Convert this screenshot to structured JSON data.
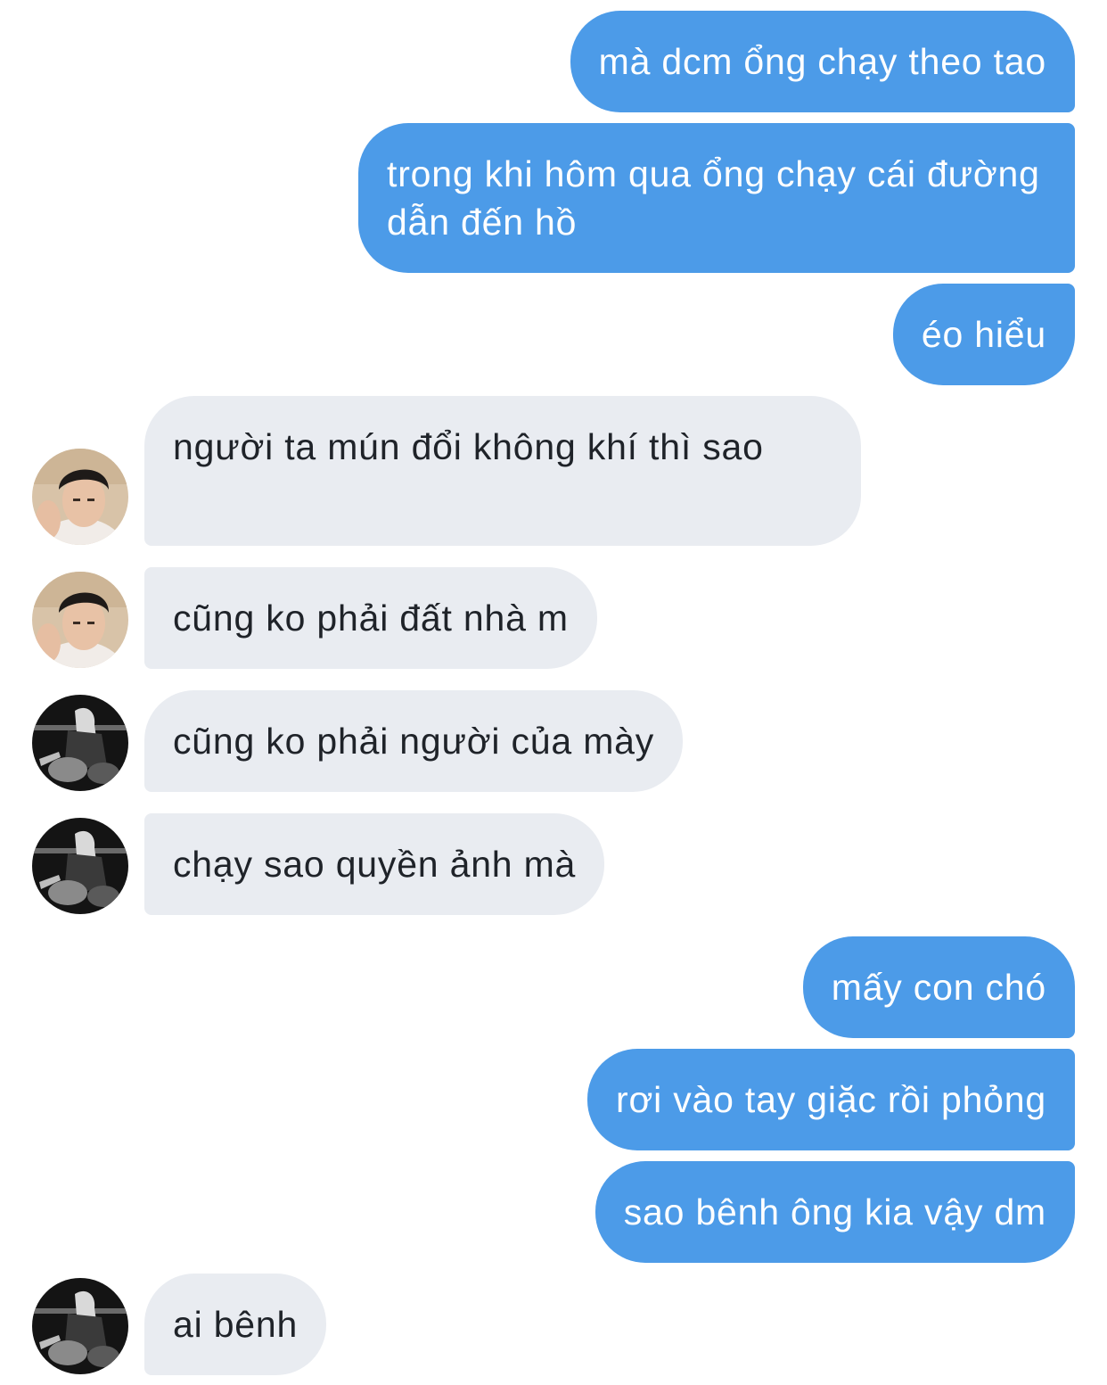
{
  "conversation": {
    "messages": [
      {
        "side": "out",
        "text": "mà dcm ổng chạy theo tao"
      },
      {
        "side": "out",
        "text": "trong khi hôm qua ổng chạy cái đường dẫn đến hồ"
      },
      {
        "side": "out",
        "text": "éo hiểu"
      },
      {
        "side": "in",
        "sender": "user-a",
        "text": "người ta mún đổi không khí thì sao"
      },
      {
        "side": "in",
        "sender": "user-a",
        "text": "cũng ko phải đất nhà m"
      },
      {
        "side": "in",
        "sender": "user-b",
        "text": "cũng ko phải người của mày"
      },
      {
        "side": "in",
        "sender": "user-b",
        "text": "chạy sao quyền ảnh mà"
      },
      {
        "side": "out",
        "text": "mấy con chó"
      },
      {
        "side": "out",
        "text": "rơi vào tay giặc rồi phỏng"
      },
      {
        "side": "out",
        "text": "sao bênh ông kia vậy dm"
      },
      {
        "side": "in",
        "sender": "user-b",
        "text": "ai bênh"
      }
    ]
  },
  "colors": {
    "outgoing_bubble": "#4c9be8",
    "incoming_bubble": "#e9ecf1",
    "outgoing_text": "#ffffff",
    "incoming_text": "#1f2329"
  }
}
